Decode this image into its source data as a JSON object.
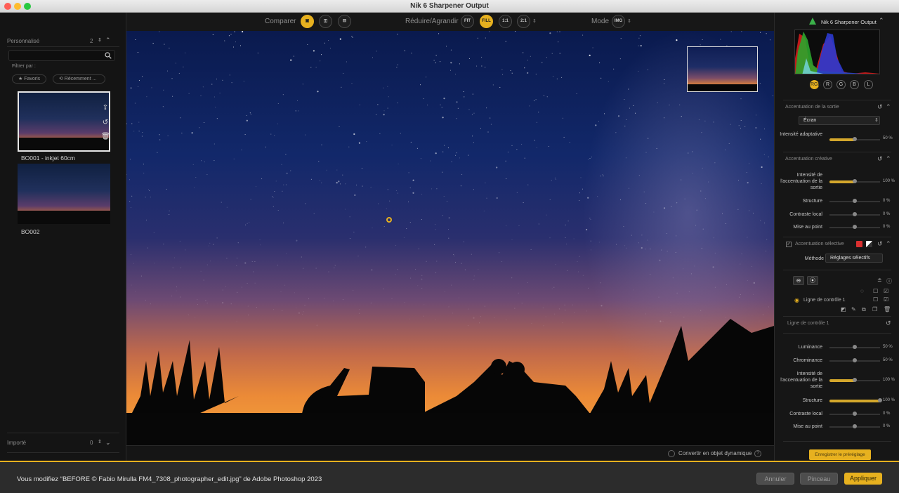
{
  "window": {
    "title": "Nik 6 Sharpener Output"
  },
  "left_panel": {
    "personalise": {
      "title": "Personnalisé",
      "count": "2"
    },
    "search": {
      "placeholder": ""
    },
    "filter_label": "Filtrer par :",
    "filters": [
      "★ Favoris",
      "⟲ Récemment ..."
    ],
    "presets": [
      {
        "label": "BO001 - inkjet 60cm"
      },
      {
        "label": "BO002"
      }
    ],
    "importe": {
      "title": "Importé",
      "count": "0"
    }
  },
  "toolbar": {
    "compare_label": "Comparer",
    "resize_label": "Réduire/Agrandir",
    "zoom_buttons": [
      "FIT",
      "FILL",
      "1:1",
      "2:1"
    ],
    "mode_label": "Mode",
    "mode_button": "IMG"
  },
  "canvas": {
    "convert_label": "Convertir en objet dynamique"
  },
  "right_panel": {
    "title": "Nik 6 Sharpener Output",
    "channels": [
      "RGB",
      "R",
      "G",
      "B",
      "L"
    ],
    "output_section": "Accentuation de la sortie",
    "output_dropdown": "Écran",
    "adaptive": {
      "label": "Intensité adaptative",
      "value": "50 %",
      "level": 0.5
    },
    "creative_section": "Accentuation créative",
    "creative_sliders": [
      {
        "label": "Intensité de l'accentuation de la sortie",
        "value": "100 %",
        "level": 0.5
      },
      {
        "label": "Structure",
        "value": "0 %",
        "level": 0.5
      },
      {
        "label": "Contraste local",
        "value": "0 %",
        "level": 0.5
      },
      {
        "label": "Mise au point",
        "value": "0 %",
        "level": 0.5
      }
    ],
    "selective_section": "Accentuation sélective",
    "method_label": "Méthode",
    "method_value": "Réglages sélectifs",
    "control_line": "Ligne de contrôle 1",
    "control_line_header": "Ligne de contrôle 1",
    "control_sliders": [
      {
        "label": "Luminance",
        "value": "50 %",
        "level": 0.5
      },
      {
        "label": "Chrominance",
        "value": "50 %",
        "level": 0.5
      },
      {
        "label": "Intensité de l'accentuation de la sortie",
        "value": "100 %",
        "level": 0.5
      },
      {
        "label": "Structure",
        "value": "100 %",
        "level": 1.0
      },
      {
        "label": "Contraste local",
        "value": "0 %",
        "level": 0.5
      },
      {
        "label": "Mise au point",
        "value": "0 %",
        "level": 0.5
      }
    ],
    "save_preset": "Enregistrer le préréglage"
  },
  "statusbar": {
    "message": "Vous modifiez “BEFORE © Fabio Mirulla FM4_7308_photographer_edit.jpg” de Adobe Photoshop 2023",
    "cancel": "Annuler",
    "brush": "Pinceau",
    "apply": "Appliquer"
  },
  "colors": {
    "accent": "#e7b11f"
  }
}
